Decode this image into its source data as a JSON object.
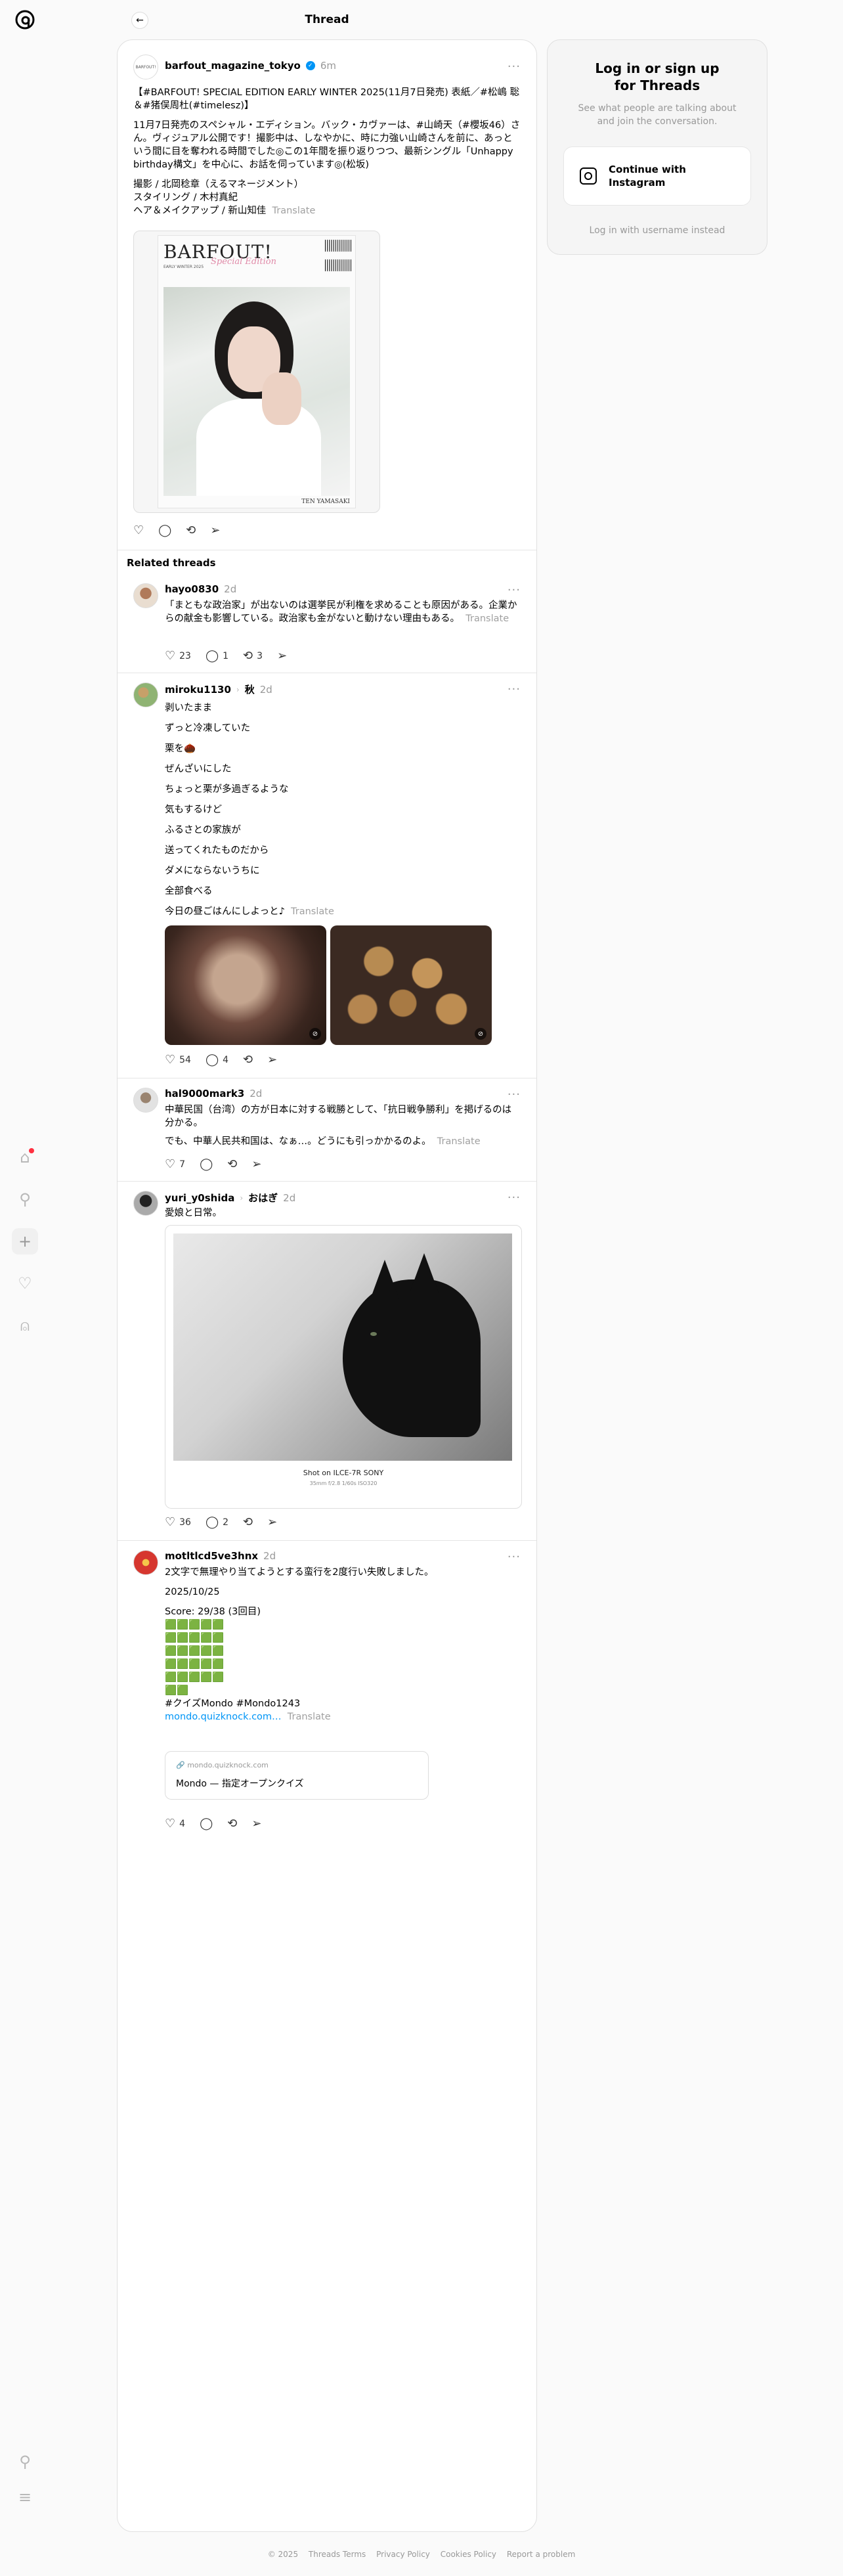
{
  "header": {
    "title": "Thread"
  },
  "main_post": {
    "username": "barfout_magazine_tokyo",
    "time": "6m",
    "avatar_text": "BARFOUT!",
    "para1": "【#BARFOUT! SPECIAL EDITION EARLY WINTER 2025(11月7日発売) 表紙／#松嶋 聡＆#猪俣周杜(#timelesz)】",
    "para2": "11月7日発売のスペシャル・エディション。バック・カヴァーは、#山崎天（#櫻坂46）さん。ヴィジュアル公開です！撮影中は、しなやかに、時に力強い山崎さんを前に、あっという間に目を奪われる時間でした◎この1年間を振り返りつつ、最新シングル「Unhappy birthday構文」を中心に、お話を伺っています◎(松坂)",
    "credit1": "撮影 / 北岡稔章（えるマネージメント）",
    "credit2": "スタイリング / 木村真紀",
    "credit3": "ヘア＆メイクアップ / 新山知佳",
    "translate": "Translate",
    "cover": {
      "masthead": "BARFOUT!",
      "script": "Special Edition",
      "issue": "EARLY WINTER 2025",
      "name": "TEN YAMASAKI"
    }
  },
  "related_title": "Related threads",
  "posts": [
    {
      "username": "hayo0830",
      "time": "2d",
      "text": "「まともな政治家」が出ないのは選挙民が利権を求めることも原因がある。企業からの献金も影響している。政治家も金がないと動けない理由もある。",
      "translate": "Translate",
      "likes": "23",
      "replies": "1",
      "reposts": "3"
    },
    {
      "username": "miroku1130",
      "topic": "秋",
      "time": "2d",
      "lines": [
        "剥いたまま",
        "ずっと冷凍していた",
        "栗を🌰",
        "ぜんざいにした",
        "ちょっと栗が多過ぎるような",
        "気もするけど",
        "ふるさとの家族が",
        "送ってくれたものだから",
        "ダメにならないうちに",
        "全部食べる",
        "今日の昼ごはんにしよっと♪"
      ],
      "translate": "Translate",
      "likes": "54",
      "replies": "4"
    },
    {
      "username": "hal9000mark3",
      "time": "2d",
      "para1": "中華民国（台湾）の方が日本に対する戦勝として、「抗日戦争勝利」を掲げるのは分かる。",
      "para2": "でも、中華人民共和国は、なぁ…。どうにも引っかかるのよ。",
      "translate": "Translate",
      "likes": "7"
    },
    {
      "username": "yuri_y0shida",
      "topic": "おはぎ",
      "time": "2d",
      "text": "愛娘と日常。",
      "exif_title": "Shot on ILCE-7R SONY",
      "exif_detail": "35mm f/2.8 1/60s ISO320",
      "likes": "36",
      "replies": "2"
    },
    {
      "username": "motltlcd5ve3hnx",
      "time": "2d",
      "line1": "2文字で無理やり当てようとする蛮行を2度行い失敗しました。",
      "date": "2025/10/25",
      "score": "Score: 29/38 (3回目)",
      "grid": [
        "🟩🟩🟩🟩🟩",
        "🟩🟩🟩🟩🟩",
        "🟩🟩🟩🟩🟩",
        "🟩🟩🟩🟩🟩",
        "🟩🟩🟩🟩🟩",
        "🟩🟩"
      ],
      "tags": "#クイズMondo #Mondo1243",
      "link": "mondo.quizknock.com…",
      "translate": "Translate",
      "card_domain": "mondo.quizknock.com",
      "card_title": "Mondo — 指定オープンクイズ",
      "likes": "4"
    }
  ],
  "login": {
    "title_line1": "Log in or sign up",
    "title_line2": "for Threads",
    "sub_line1": "See what people are talking about",
    "sub_line2": "and join the conversation.",
    "btn_line1": "Continue with",
    "btn_line2": "Instagram",
    "alt": "Log in with username instead"
  },
  "footer": {
    "copyright": "© 2025",
    "terms": "Threads Terms",
    "privacy": "Privacy Policy",
    "cookies": "Cookies Policy",
    "report": "Report a problem"
  },
  "colors": {
    "accent": "#0095f6",
    "notification": "#ff3040",
    "muted": "#999999"
  },
  "icons": [
    "threads-logo-icon",
    "home-icon",
    "search-icon",
    "plus-icon",
    "heart-icon",
    "profile-icon",
    "pin-icon",
    "menu-icon",
    "back-arrow-icon",
    "more-icon",
    "like-icon",
    "reply-icon",
    "repost-icon",
    "share-icon",
    "mute-icon",
    "instagram-icon"
  ]
}
